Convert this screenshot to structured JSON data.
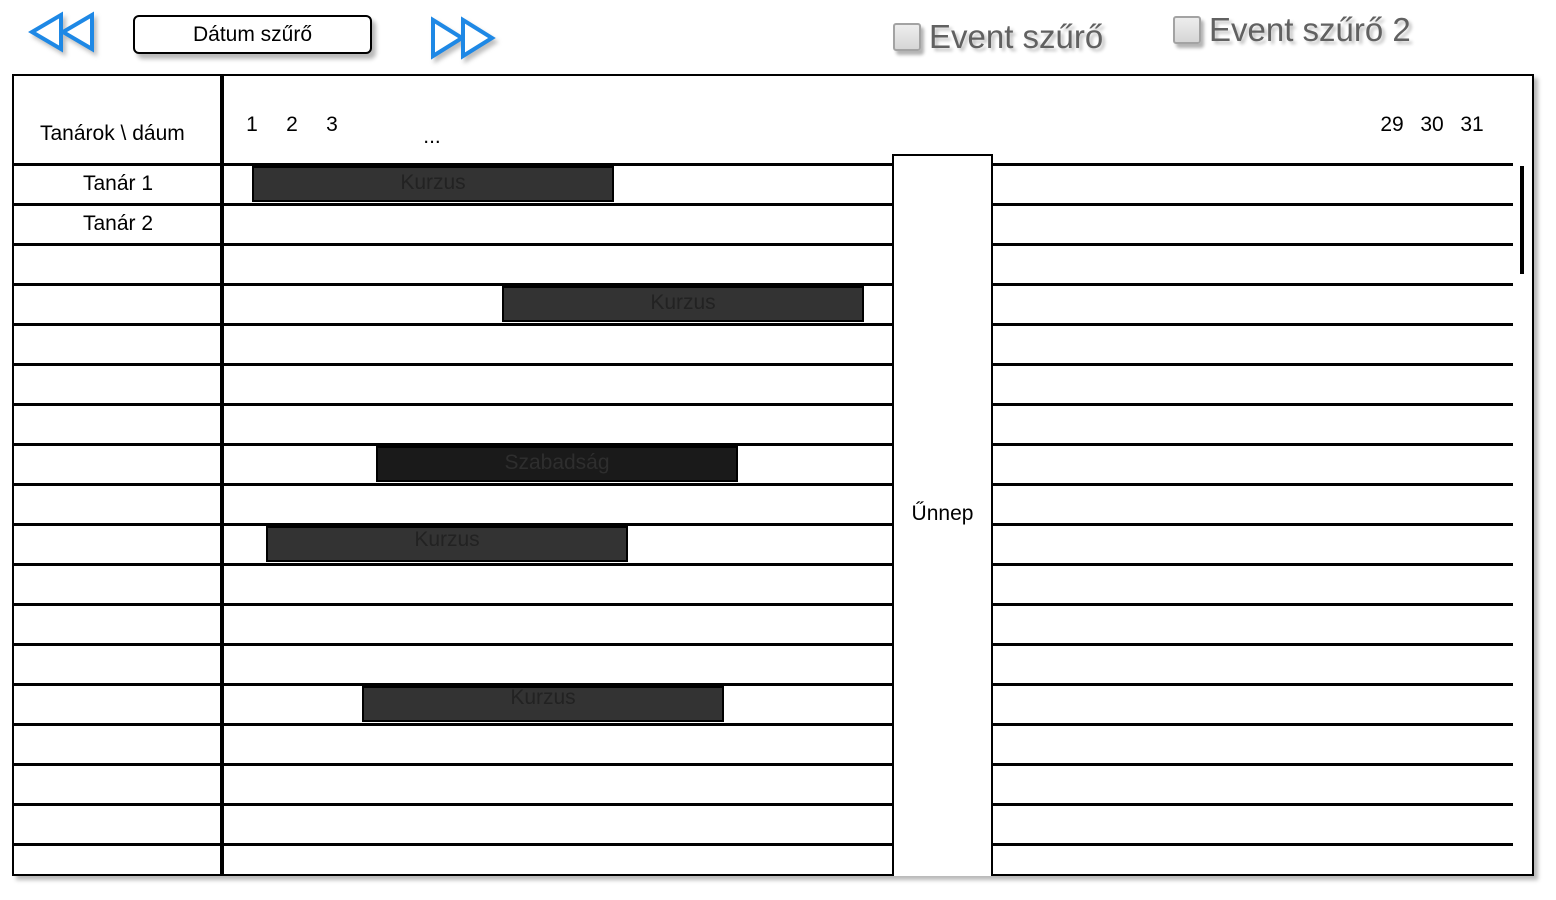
{
  "toolbar": {
    "prev_icon": "double-chevron-left-icon",
    "next_icon": "double-chevron-right-icon",
    "date_filter_label": "Dátum szűrő",
    "event_filter_1_label": "Event szűrő",
    "event_filter_2_label": "Event szűrő 2",
    "accent_color": "#1e88e5"
  },
  "calendar": {
    "corner_header": "Tanárok \\ dáum",
    "days_start": [
      "1",
      "2",
      "3"
    ],
    "days_ellipsis": "...",
    "days_end": [
      "29",
      "30",
      "31"
    ],
    "teachers": [
      "Tanár 1",
      "Tanár 2"
    ],
    "events": [
      {
        "label": "Kurzus",
        "kind": "course"
      },
      {
        "label": "Kurzus",
        "kind": "course"
      },
      {
        "label": "Szabadság",
        "kind": "leave"
      },
      {
        "label": "Kurzus",
        "kind": "course"
      },
      {
        "label": "Kurzus",
        "kind": "course"
      }
    ],
    "holiday_label": "Űnnep"
  }
}
